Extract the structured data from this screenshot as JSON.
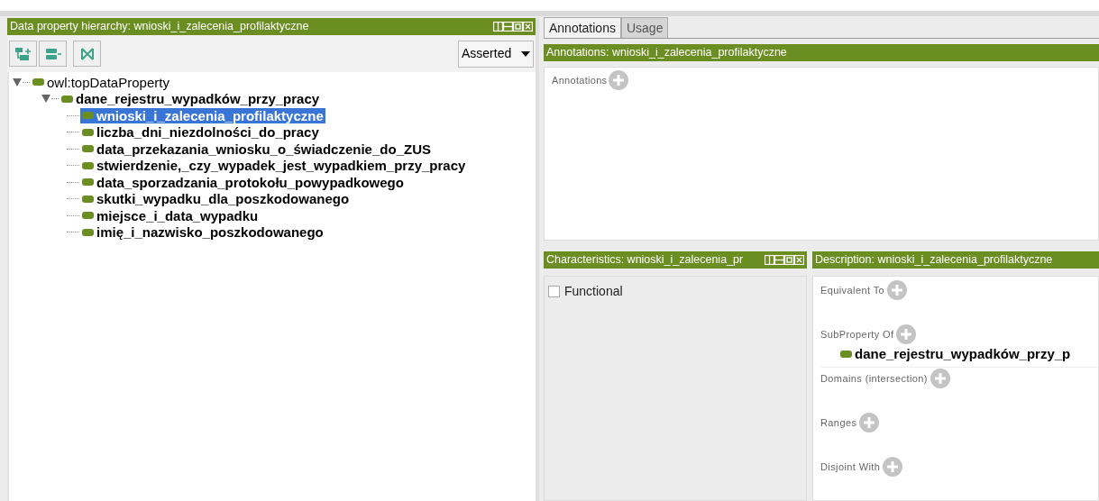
{
  "hierarchy_panel": {
    "title": "Data property hierarchy: wnioski_i_zalecenia_profilaktyczne",
    "toolbar": {
      "dropdown": "Asserted"
    },
    "tree": [
      {
        "label": "owl:topDataProperty",
        "expanded": true,
        "selected": false,
        "children": [
          {
            "label": "dane_rejestru_wypadków_przy_pracy",
            "expanded": true,
            "selected": false,
            "children": [
              {
                "label": "wnioski_i_zalecenia_profilaktyczne",
                "selected": true
              },
              {
                "label": "liczba_dni_niezdolności_do_pracy",
                "selected": false
              },
              {
                "label": "data_przekazania_wniosku_o_świadczenie_do_ZUS",
                "selected": false
              },
              {
                "label": "stwierdzenie,_czy_wypadek_jest_wypadkiem_przy_pracy",
                "selected": false
              },
              {
                "label": "data_sporzadzania_protokołu_powypadkowego",
                "selected": false
              },
              {
                "label": "skutki_wypadku_dla_poszkodowanego",
                "selected": false
              },
              {
                "label": "miejsce_i_data_wypadku",
                "selected": false
              },
              {
                "label": "imię_i_nazwisko_poszkodowanego",
                "selected": false
              }
            ]
          }
        ]
      }
    ]
  },
  "tabs": [
    {
      "label": "Annotations",
      "selected": true
    },
    {
      "label": "Usage",
      "selected": false
    }
  ],
  "annotations_panel": {
    "title": "Annotations: wnioski_i_zalecenia_profilaktyczne",
    "section": "Annotations"
  },
  "characteristics_panel": {
    "title": "Characteristics: wnioski_i_zalecenia_pr",
    "items": [
      {
        "label": "Functional",
        "checked": false
      }
    ]
  },
  "description_panel": {
    "title": "Description: wnioski_i_zalecenia_profilaktyczne",
    "sections": [
      {
        "label": "Equivalent To"
      },
      {
        "label": "SubProperty Of",
        "items": [
          "dane_rejestru_wypadków_przy_p"
        ]
      },
      {
        "label": "Domains (intersection)"
      },
      {
        "label": "Ranges"
      },
      {
        "label": "Disjoint With"
      }
    ]
  }
}
